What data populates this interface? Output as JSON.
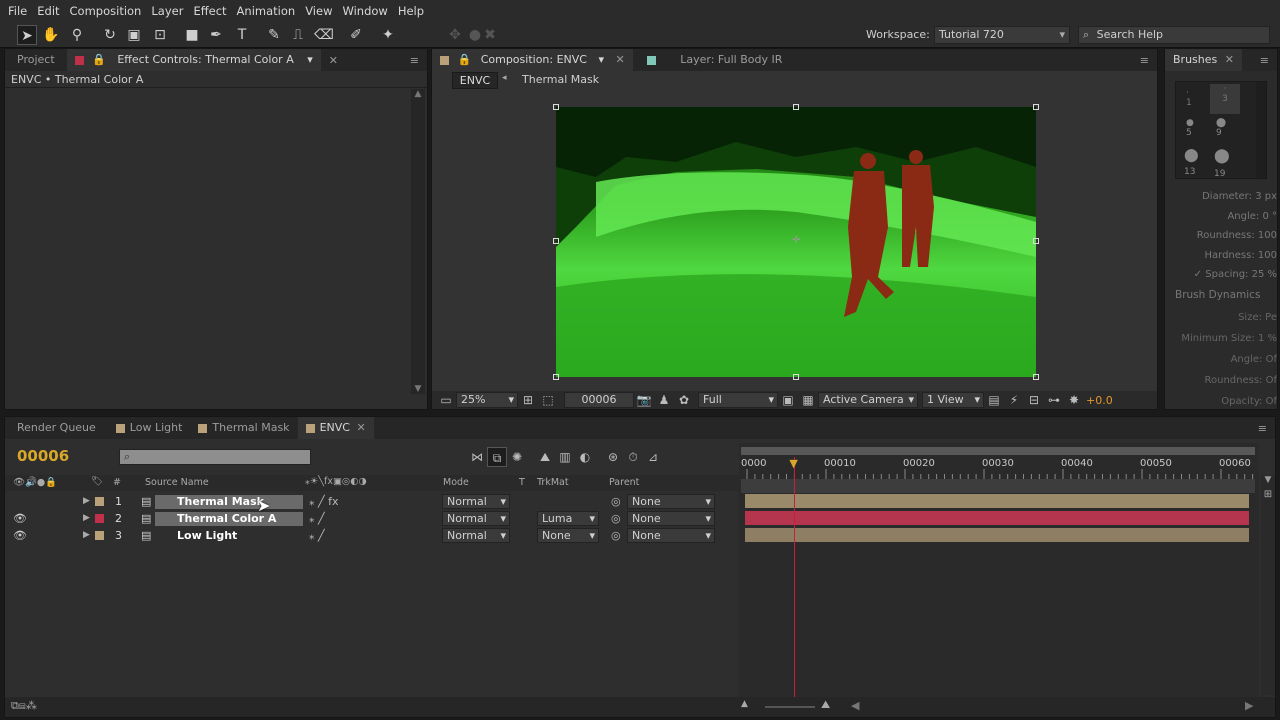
{
  "menu": [
    "File",
    "Edit",
    "Composition",
    "Layer",
    "Effect",
    "Animation",
    "View",
    "Window",
    "Help"
  ],
  "workspace": {
    "label": "Workspace:",
    "value": "Tutorial 720"
  },
  "search_help": {
    "placeholder": "Search Help"
  },
  "left_panel": {
    "tab_project": "Project",
    "tab_effect_controls": "Effect Controls: Thermal Color A",
    "breadcrumb": "ENVC • Thermal Color A"
  },
  "comp_panel": {
    "tab_composition": "Composition: ENVC",
    "tab_layer": "Layer: Full Body IR",
    "nav_current": "ENVC",
    "nav_next": "Thermal Mask",
    "zoom": "25%",
    "timecode": "00006",
    "resolution": "Full",
    "camera": "Active Camera",
    "view": "1 View",
    "exposure": "+0.0"
  },
  "brushes": {
    "tab": "Brushes",
    "sizes": [
      "1",
      "3",
      "5",
      "9",
      "13",
      "19"
    ],
    "props": [
      {
        "label": "Diameter:",
        "value": "3 px"
      },
      {
        "label": "Angle:",
        "value": "0 °"
      },
      {
        "label": "Roundness:",
        "value": "100"
      },
      {
        "label": "Hardness:",
        "value": "100"
      },
      {
        "label": "Spacing:",
        "value": "25 %"
      }
    ],
    "dynamics_title": "Brush Dynamics",
    "dynamics": [
      {
        "label": "Size:",
        "value": "Pe"
      },
      {
        "label": "Minimum Size:",
        "value": "1 %"
      },
      {
        "label": "Angle:",
        "value": "Of"
      },
      {
        "label": "Roundness:",
        "value": "Of"
      },
      {
        "label": "Opacity:",
        "value": "Of"
      }
    ]
  },
  "timeline_tabs": [
    "Render Queue",
    "Low Light",
    "Thermal Mask",
    "ENVC"
  ],
  "timeline": {
    "timecode": "00006",
    "columns": {
      "hash": "#",
      "source": "Source Name",
      "mode": "Mode",
      "t": "T",
      "trkmat": "TrkMat",
      "parent": "Parent"
    },
    "ruler": [
      "0000",
      "00010",
      "00020",
      "00030",
      "00040",
      "00050",
      "00060"
    ],
    "layers": [
      {
        "num": "1",
        "name": "Thermal Mask",
        "mode": "Normal",
        "trkmat": "",
        "parent": "None",
        "color": "#b9a27a",
        "bar": "#9a8a6a"
      },
      {
        "num": "2",
        "name": "Thermal Color A",
        "mode": "Normal",
        "trkmat": "Luma",
        "parent": "None",
        "color": "#c0304a",
        "bar": "#b5344e"
      },
      {
        "num": "3",
        "name": "Low Light",
        "mode": "Normal",
        "trkmat": "None",
        "parent": "None",
        "color": "#b9a27a",
        "bar": "#8e7f64"
      }
    ],
    "playhead_frame": 6
  }
}
